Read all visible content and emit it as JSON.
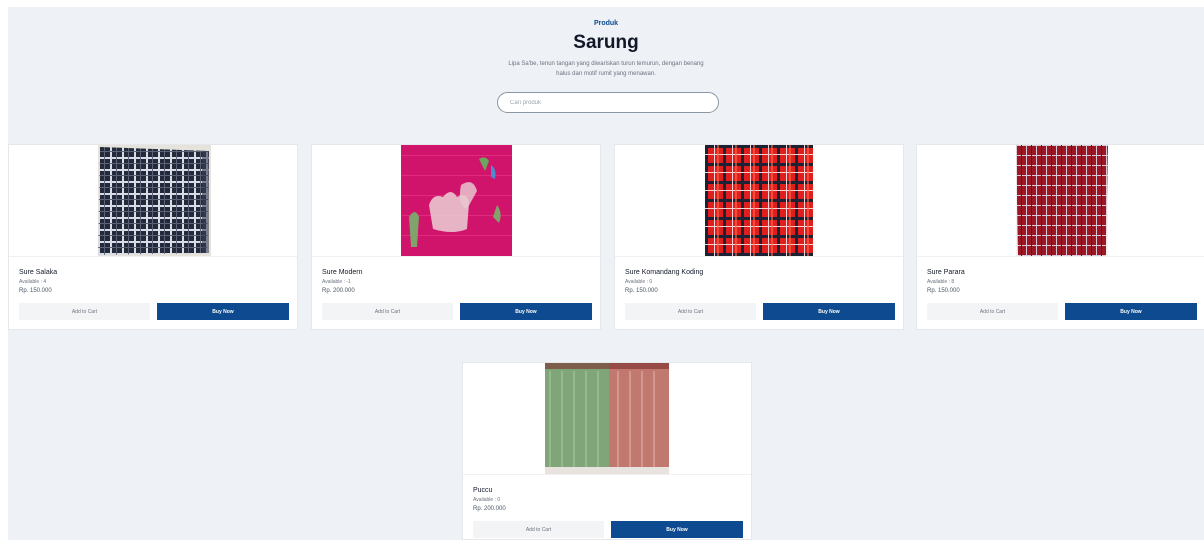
{
  "header": {
    "eyebrow": "Produk",
    "title": "Sarung",
    "description": "Lipa Sa'be, tenun tangan yang diwariskan turun temurun, dengan benang halus dan motif rumit yang menawan."
  },
  "search": {
    "placeholder": "Cari produk",
    "value": ""
  },
  "buttons": {
    "add_to_cart": "Add to Cart",
    "buy_now": "Buy Now"
  },
  "products": [
    {
      "name": "Sure Salaka",
      "available": "Available : 4",
      "price": "Rp. 150.000",
      "image": "dark-blue-plaid-sarong"
    },
    {
      "name": "Sure Modern",
      "available": "Available : -1",
      "price": "Rp. 200.000",
      "image": "pink-motif-sarong"
    },
    {
      "name": "Sure Komandang Koding",
      "available": "Available : 0",
      "price": "Rp. 150.000",
      "image": "red-plaid-sarong"
    },
    {
      "name": "Sure Parara",
      "available": "Available : 8",
      "price": "Rp. 150.000",
      "image": "maroon-plaid-sarong"
    },
    {
      "name": "Puccu",
      "available": "Available : 0",
      "price": "Rp. 200.000",
      "image": "green-pink-sarong"
    }
  ],
  "colors": {
    "primary": "#0e4a8f",
    "background": "#eef1f5",
    "card": "#ffffff"
  }
}
